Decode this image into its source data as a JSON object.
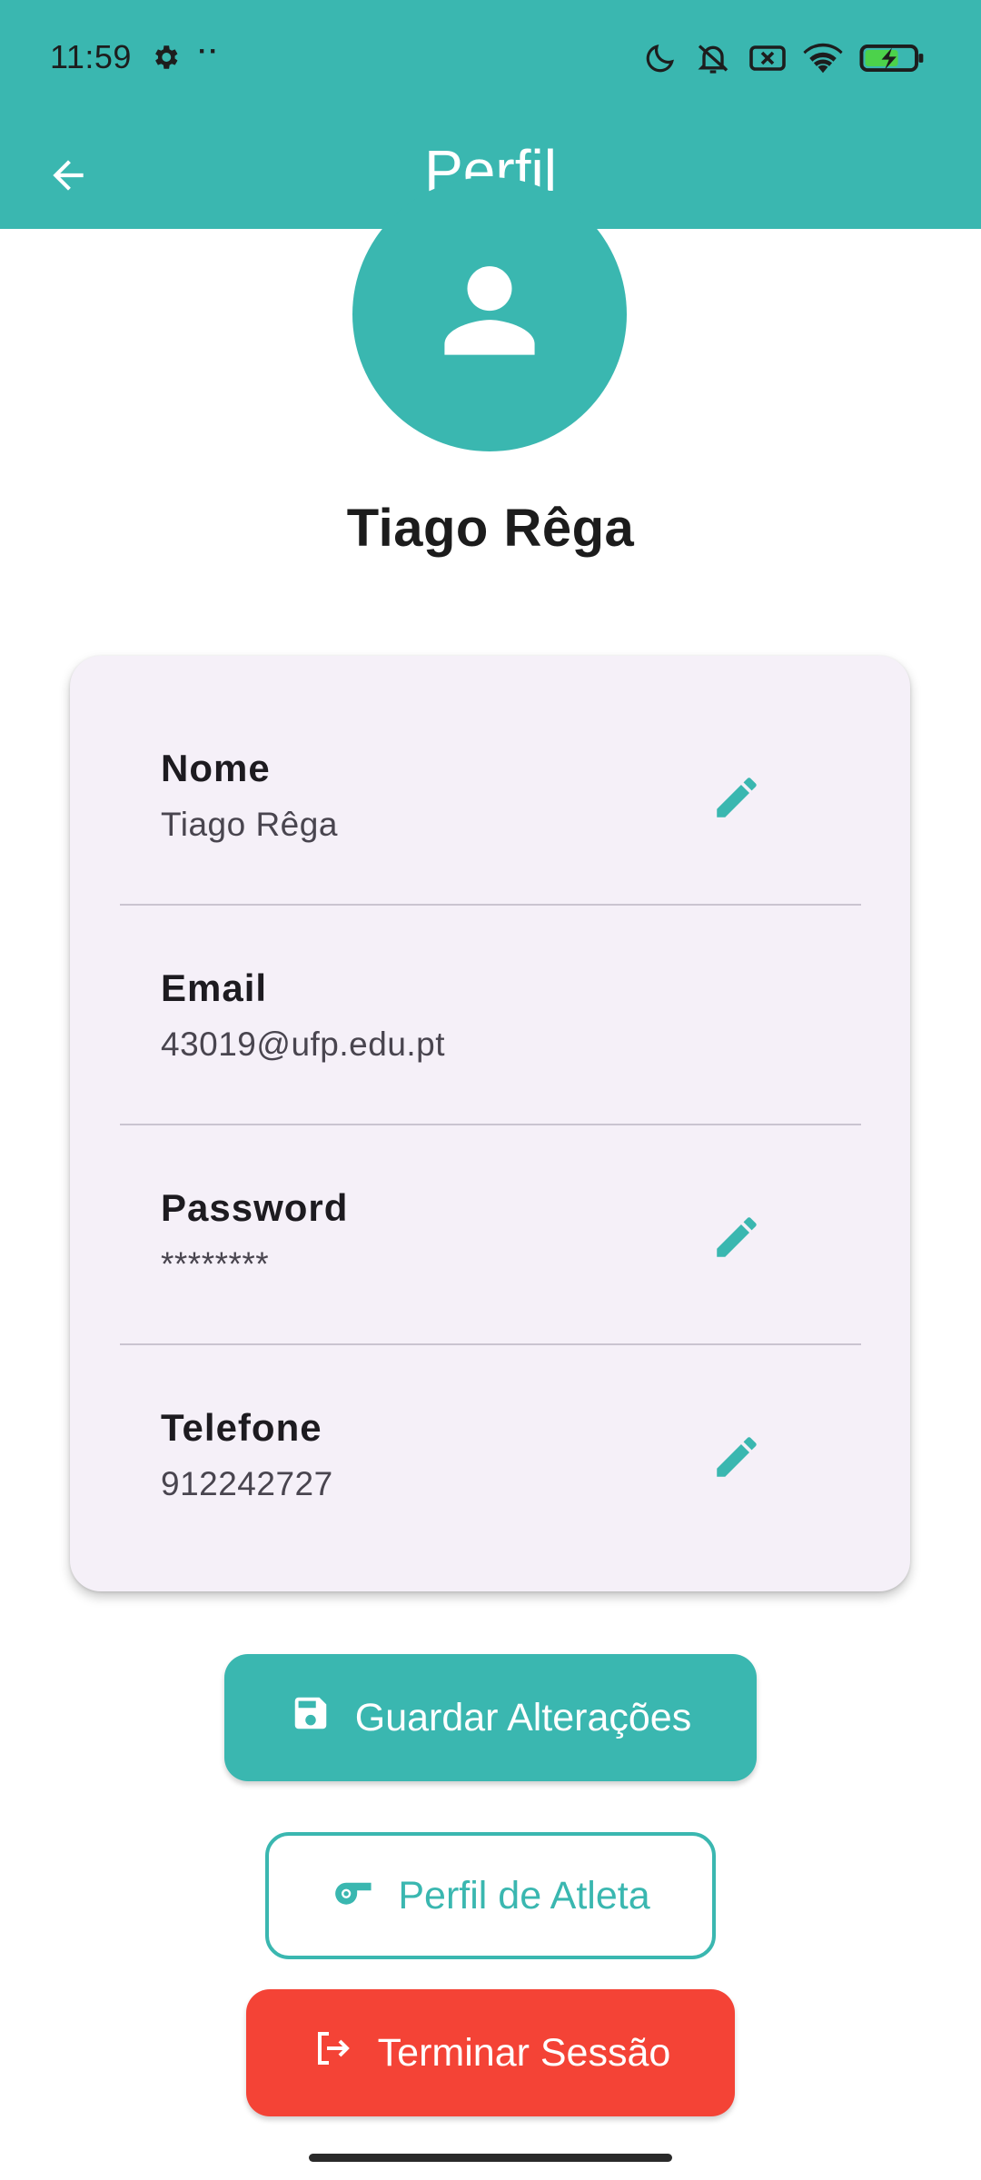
{
  "status_bar": {
    "time": "11:59",
    "dots": "··",
    "icons": [
      "gear-icon",
      "moon-icon",
      "silent-icon",
      "no-sim-icon",
      "wifi-icon",
      "battery-charging-icon"
    ]
  },
  "app_bar": {
    "title": "Perfil",
    "back_icon": "arrow-back-icon"
  },
  "profile": {
    "avatar_icon": "person-icon",
    "name": "Tiago Rêga"
  },
  "fields": [
    {
      "label": "Nome",
      "value": "Tiago Rêga",
      "editable": true
    },
    {
      "label": "Email",
      "value": "43019@ufp.edu.pt",
      "editable": false
    },
    {
      "label": "Password",
      "value": "********",
      "editable": true
    },
    {
      "label": "Telefone",
      "value": "912242727",
      "editable": true
    }
  ],
  "actions": {
    "save_label": "Guardar Alterações",
    "athlete_label": "Perfil de Atleta",
    "logout_label": "Terminar Sessão"
  },
  "colors": {
    "primary": "#3ab7b0",
    "card_background": "#f5f0f8",
    "danger": "#f44336"
  }
}
